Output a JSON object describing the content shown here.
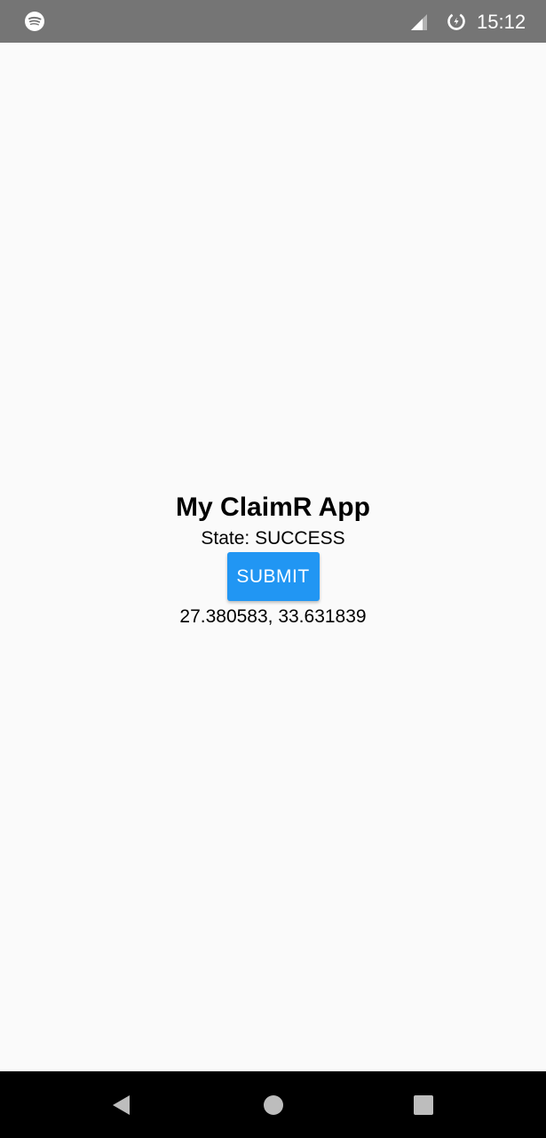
{
  "status_bar": {
    "time": "15:12",
    "icons": [
      "spotify-icon",
      "signal-icon",
      "data-saver-icon"
    ]
  },
  "app": {
    "title": "My ClaimR App",
    "state": "State: SUCCESS",
    "submit_label": "SUBMIT",
    "coordinates": "27.380583, 33.631839"
  },
  "nav_bar": {
    "icons": [
      "back-icon",
      "home-icon",
      "recents-icon"
    ]
  },
  "colors": {
    "status_bar": "#757575",
    "background": "#fafafa",
    "button": "#2196f3",
    "nav_bar": "#000000"
  }
}
